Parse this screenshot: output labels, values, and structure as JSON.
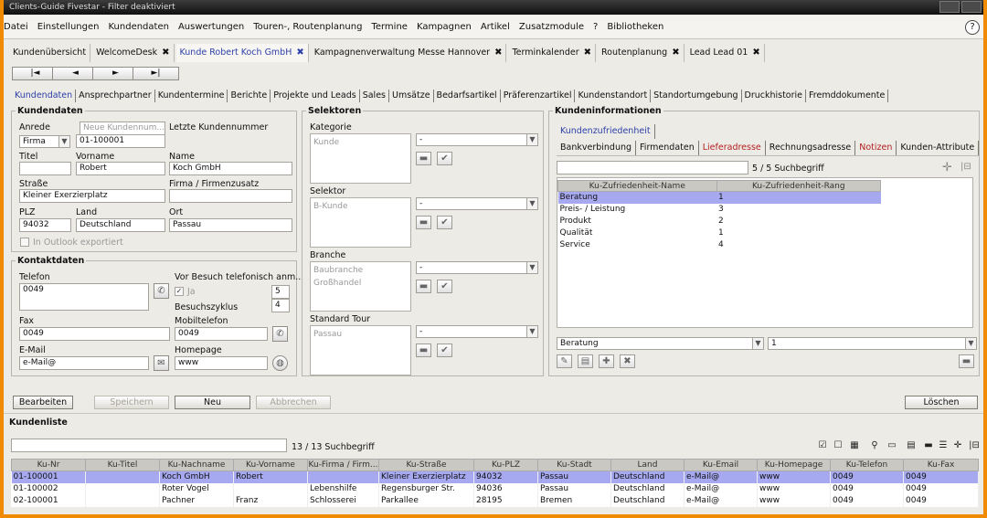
{
  "window_title": "Clients-Guide Fivestar - Filter deaktiviert",
  "menu": [
    "Datei",
    "Einstellungen",
    "Kundendaten",
    "Auswertungen",
    "Touren-, Routenplanung",
    "Termine",
    "Kampagnen",
    "Artikel",
    "Zusatzmodule",
    "?",
    "Bibliotheken"
  ],
  "doc_tabs": [
    {
      "label": "Kundenübersicht",
      "closable": false
    },
    {
      "label": "WelcomeDesk",
      "closable": true
    },
    {
      "label": "Kunde Robert Koch GmbH",
      "closable": true,
      "active": true
    },
    {
      "label": "Kampagnenverwaltung Messe Hannover",
      "closable": true
    },
    {
      "label": "Terminkalender",
      "closable": true
    },
    {
      "label": "Routenplanung",
      "closable": true
    },
    {
      "label": "Lead Lead 01",
      "closable": true
    }
  ],
  "nav": {
    "first": "|◄",
    "prev": "◄",
    "next": "►",
    "last": "►|"
  },
  "content_tabs": [
    "Kundendaten",
    "Ansprechpartner",
    "Kundentermine",
    "Berichte",
    "Projekte und Leads",
    "Sales",
    "Umsätze",
    "Bedarfsartikel",
    "Präferenzartikel",
    "Kundenstandort",
    "Standortumgebung",
    "Druckhistorie",
    "Fremddokumente"
  ],
  "kundendaten": {
    "title": "Kundendaten",
    "anrede_label": "Anrede",
    "anrede_value": "Firma",
    "neue_kundennummer": "Neue Kundennum...",
    "letzte_label": "Letzte Kundennummer",
    "kundennummer": "01-100001",
    "titel_label": "Titel",
    "titel_value": "",
    "vorname_label": "Vorname",
    "vorname_value": "Robert",
    "name_label": "Name",
    "name_value": "Koch GmbH",
    "strasse_label": "Straße",
    "strasse_value": "Kleiner Exerzierplatz",
    "firmenzusatz_label": "Firma / Firmenzusatz",
    "firmenzusatz_value": "",
    "plz_label": "PLZ",
    "plz_value": "94032",
    "land_label": "Land",
    "land_value": "Deutschland",
    "ort_label": "Ort",
    "ort_value": "Passau",
    "outlook_label": "In Outlook exportiert"
  },
  "kontaktdaten": {
    "title": "Kontaktdaten",
    "telefon_label": "Telefon",
    "telefon_value": "0049",
    "vor_besuch_label": "Vor Besuch telefonisch anm...",
    "ja_label": "Ja",
    "vor_besuch_value": "5",
    "besuchszyklus_label": "Besuchszyklus",
    "besuchszyklus_value": "4",
    "fax_label": "Fax",
    "fax_value": "0049",
    "mobil_label": "Mobiltelefon",
    "mobil_value": "0049",
    "email_label": "E-Mail",
    "email_value": "e-Mail@",
    "homepage_label": "Homepage",
    "homepage_value": "www"
  },
  "selektoren": {
    "title": "Selektoren",
    "groups": [
      {
        "label": "Kategorie",
        "items": [
          "Kunde"
        ],
        "combo": "-"
      },
      {
        "label": "Selektor",
        "items": [
          "B-Kunde"
        ],
        "combo": "-"
      },
      {
        "label": "Branche",
        "items": [
          "Baubranche",
          "Großhandel"
        ],
        "combo": "-"
      },
      {
        "label": "Standard Tour",
        "items": [
          "Passau"
        ],
        "combo": "-"
      }
    ]
  },
  "kundeninformationen": {
    "title": "Kundeninformationen",
    "top_tab": "Kundenzufriedenheit",
    "subtabs": [
      {
        "label": "Bankverbindung",
        "red": false
      },
      {
        "label": "Firmendaten",
        "red": false
      },
      {
        "label": "Lieferadresse",
        "red": true
      },
      {
        "label": "Rechnungsadresse",
        "red": false
      },
      {
        "label": "Notizen",
        "red": true
      },
      {
        "label": "Kunden-Attribute",
        "red": false
      }
    ],
    "search_count": "5 / 5 Suchbegriff",
    "col_name": "Ku-Zufriedenheit-Name",
    "col_rang": "Ku-Zufriedenheit-Rang",
    "rows": [
      {
        "name": "Beratung",
        "rang": "1"
      },
      {
        "name": "Preis- / Leistung",
        "rang": "3"
      },
      {
        "name": "Produkt",
        "rang": "2"
      },
      {
        "name": "Qualität",
        "rang": "1"
      },
      {
        "name": "Service",
        "rang": "4"
      }
    ],
    "edit_name": "Beratung",
    "edit_rang": "1"
  },
  "buttons": {
    "bearbeiten": "Bearbeiten",
    "speichern": "Speichern",
    "neu": "Neu",
    "abbrechen": "Abbrechen",
    "loeschen": "Löschen"
  },
  "kundenliste": {
    "title": "Kundenliste",
    "search_count": "13 / 13 Suchbegriff",
    "columns": [
      "Ku-Nr",
      "Ku-Titel",
      "Ku-Nachname",
      "Ku-Vorname",
      "Ku-Firma / Firm...",
      "Ku-Straße",
      "Ku-PLZ",
      "Ku-Stadt",
      "Land",
      "Ku-Email",
      "Ku-Homepage",
      "Ku-Telefon",
      "Ku-Fax"
    ],
    "rows": [
      [
        "01-100001",
        "",
        "Koch GmbH",
        "Robert",
        "",
        "Kleiner Exerzierplatz",
        "94032",
        "Passau",
        "Deutschland",
        "e-Mail@",
        "www",
        "0049",
        "0049"
      ],
      [
        "01-100002",
        "",
        "Roter Vogel",
        "",
        "Lebenshilfe",
        "Regensburger Str.",
        "94036",
        "Passau",
        "Deutschland",
        "e-Mail@",
        "www",
        "0049",
        "0049"
      ],
      [
        "02-100001",
        "",
        "Pachner",
        "Franz",
        "Schlosserei",
        "Parkallee",
        "28195",
        "Bremen",
        "Deutschland",
        "e-Mail@",
        "www",
        "0049",
        "0049"
      ]
    ]
  },
  "colors": {
    "accent": "#2d3fa8",
    "selection": "#a6a8f0",
    "frame": "#f08a00",
    "warning": "#b31e1e"
  }
}
